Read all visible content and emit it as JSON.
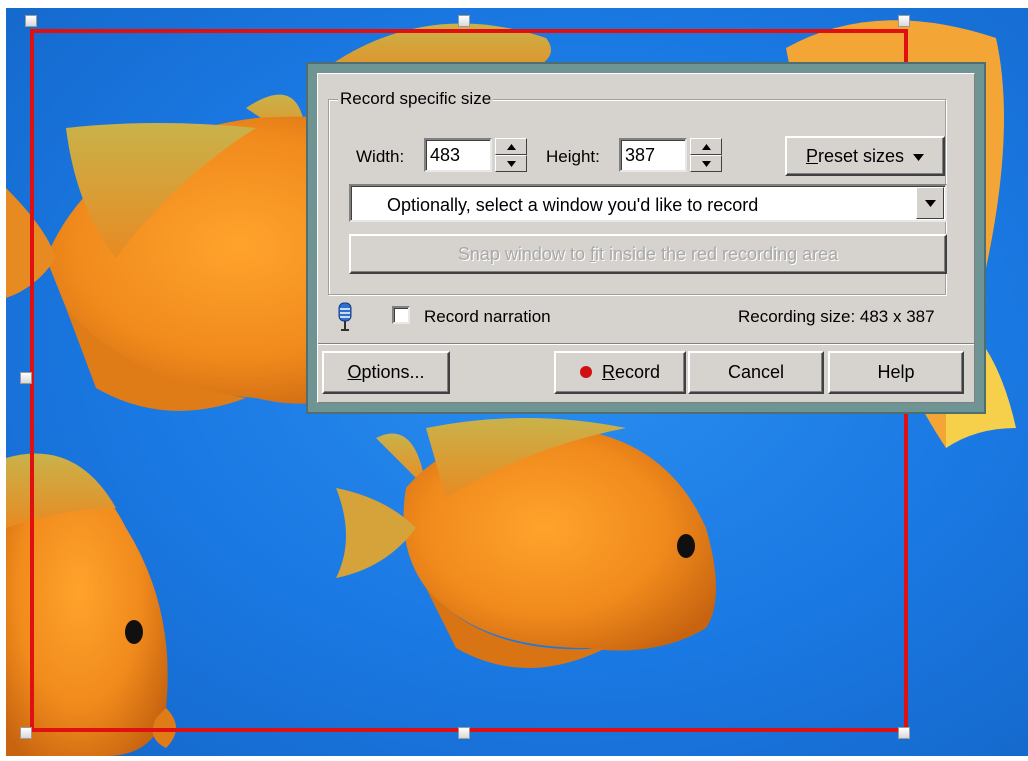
{
  "dialog": {
    "group_title": "Record specific size",
    "width_label": "Width:",
    "width_value": "483",
    "height_label": "Height:",
    "height_value": "387",
    "preset_label": "Preset sizes",
    "preset_mnemonic": "P",
    "preset_rest": "reset sizes",
    "window_select_text": "Optionally, select a window you'd like to record",
    "snap_text_pre": "Snap window to ",
    "snap_text_mnemonic": "f",
    "snap_text_post": "it inside the red recording area",
    "narration_label": "Record narration",
    "narration_checked": false,
    "recording_size_text": "Recording size: 483 x 387",
    "options_mnemonic": "O",
    "options_rest": "ptions...",
    "record_mnemonic": "R",
    "record_rest": "ecord",
    "cancel_label": "Cancel",
    "help_label": "Help"
  },
  "colors": {
    "recording_frame": "#e01010",
    "record_dot": "#d01010",
    "dialog_border": "#6f9494",
    "wallpaper": "#1a78e2",
    "fish": "#f08a1c"
  },
  "icons": {
    "microphone": "microphone-icon",
    "preset_arrow": "triangle-down-icon",
    "select_arrow": "triangle-down-icon",
    "record_dot": "record-dot-icon"
  }
}
